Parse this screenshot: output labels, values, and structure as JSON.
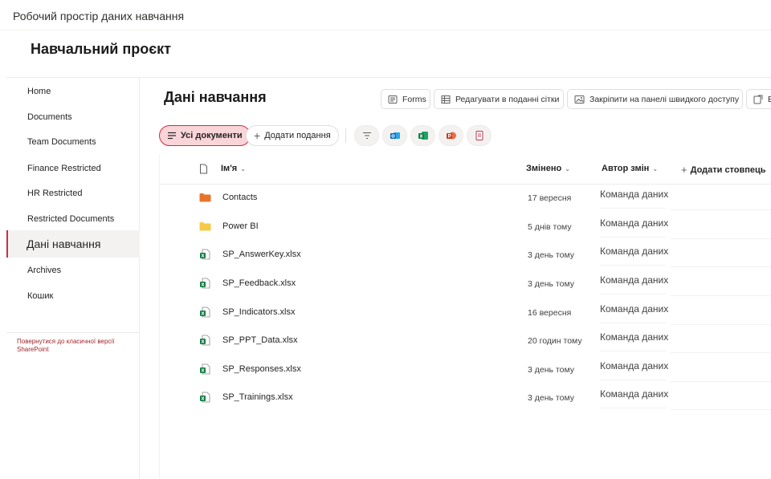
{
  "window": {
    "title": "Робочий простір даних навчання"
  },
  "site": {
    "title": "Навчальний проєкт"
  },
  "nav": {
    "items": [
      {
        "label": "Home"
      },
      {
        "label": "Documents"
      },
      {
        "label": "Team Documents"
      },
      {
        "label": "Finance Restricted"
      },
      {
        "label": "HR Restricted"
      },
      {
        "label": "Restricted Documents"
      },
      {
        "label": "Дані навчання",
        "active": true
      },
      {
        "label": "Archives"
      },
      {
        "label": "Кошик"
      }
    ],
    "classic_link": "Повернутися до класичної версії SharePoint"
  },
  "page": {
    "title": "Дані навчання"
  },
  "commands": {
    "forms": "Forms",
    "grid_edit": "Редагувати в поданні сітки",
    "pin": "Закріпити на панелі швидкого доступу",
    "more": "Ек"
  },
  "views": {
    "all_docs": "Усі документи",
    "add_view": "Додати подання"
  },
  "columns": {
    "name": "Ім'я",
    "modified": "Змінено",
    "author": "Автор змін",
    "add_column": "Додати стовпець"
  },
  "rows": [
    {
      "type": "folder",
      "name": "Contacts",
      "modified": "17 вересня",
      "author": "Команда даних",
      "icon": "folder-orange-icon"
    },
    {
      "type": "folder",
      "name": "Power BI",
      "modified": "5 днів тому",
      "author": "Команда даних",
      "icon": "folder-yellow-icon"
    },
    {
      "type": "excel",
      "name": "SP_AnswerKey.xlsx",
      "modified": "3 день тому",
      "author": "Команда даних",
      "icon": "excel-file-icon"
    },
    {
      "type": "excel",
      "name": "SP_Feedback.xlsx",
      "modified": "3 день тому",
      "author": "Команда даних",
      "icon": "excel-file-icon"
    },
    {
      "type": "excel",
      "name": "SP_Indicators.xlsx",
      "modified": "16 вересня",
      "author": "Команда даних",
      "icon": "excel-file-icon"
    },
    {
      "type": "excel",
      "name": "SP_PPT_Data.xlsx",
      "modified": "20 годин тому",
      "author": "Команда даних",
      "icon": "excel-file-icon"
    },
    {
      "type": "excel",
      "name": "SP_Responses.xlsx",
      "modified": "3 день тому",
      "author": "Команда даних",
      "icon": "excel-file-icon"
    },
    {
      "type": "excel",
      "name": "SP_Trainings.xlsx",
      "modified": "3 день тому",
      "author": "Команда даних",
      "icon": "excel-file-icon"
    }
  ],
  "colors": {
    "accent": "#c4314b",
    "accent_bg": "#f9d4d8",
    "folder_orange": "#e8742b",
    "folder_yellow": "#f7c948",
    "excel_green": "#107c41"
  }
}
